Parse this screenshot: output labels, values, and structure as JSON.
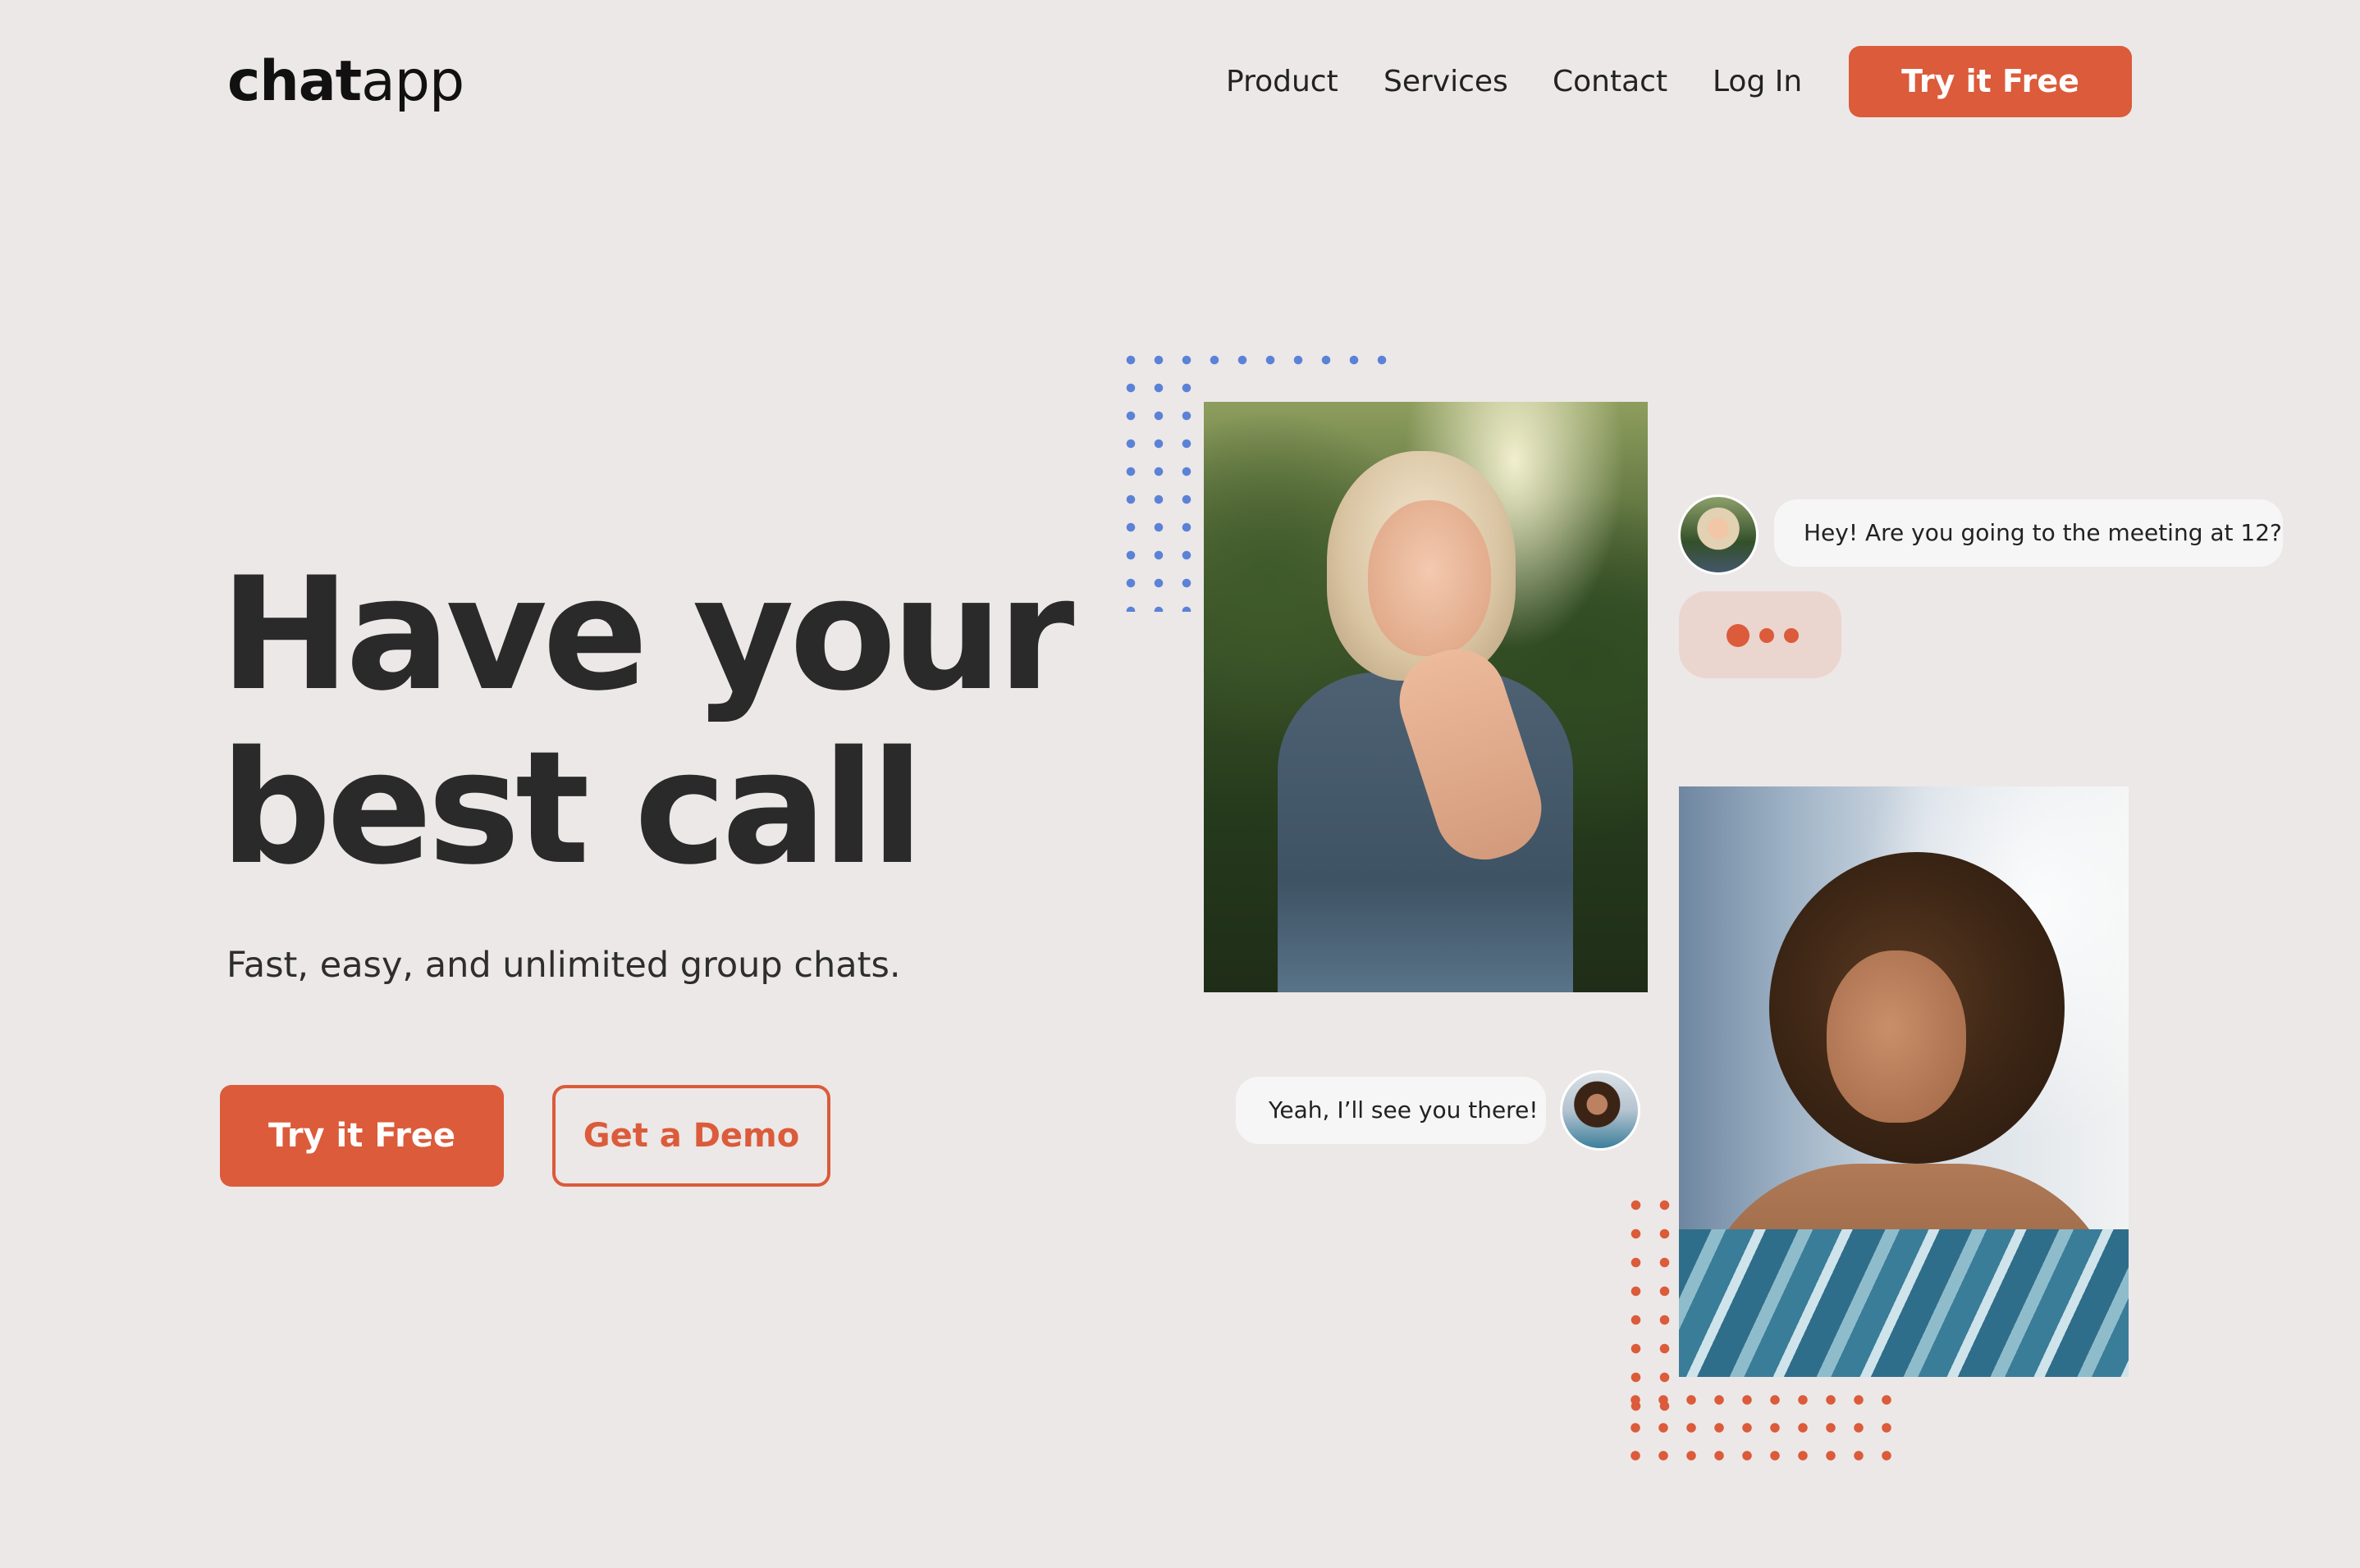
{
  "brand": {
    "logo_bold": "chat",
    "logo_light": "app"
  },
  "nav": {
    "links": [
      "Product",
      "Services",
      "Contact",
      "Log In"
    ],
    "cta_label": "Try it Free"
  },
  "hero": {
    "title_line1": "Have your",
    "title_line2": "best call",
    "subtitle": "Fast, easy, and unlimited group chats.",
    "primary_cta": "Try it Free",
    "secondary_cta": "Get a Demo"
  },
  "chat": {
    "incoming_message": "Hey! Are you going to the meeting at 12?",
    "outgoing_message": "Yeah, I’ll see you there!"
  },
  "colors": {
    "background": "#ECE8E7",
    "accent": "#DB5B3A",
    "dots_blue": "#5B82D6",
    "text": "#2B2B2B",
    "bubble": "#F7F6F6",
    "typing_bubble": "#EBD5CF"
  }
}
